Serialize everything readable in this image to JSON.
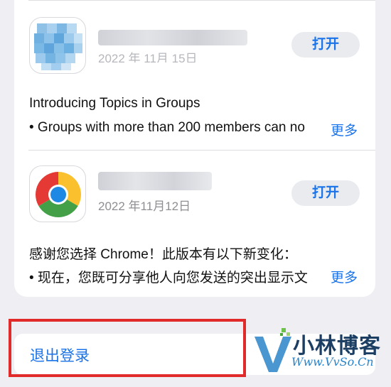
{
  "apps": [
    {
      "date": "2022 年 11月 15日",
      "open_label": "打开",
      "note_title": "Introducing Topics in Groups",
      "note_line": "• Groups with more than 200 members can no",
      "more_label": "更多"
    },
    {
      "date": "2022 年11月12日",
      "open_label": "打开",
      "note_title": "感谢您选择 Chrome！此版本有以下新变化：",
      "note_line": "• 现在，您既可分享他人向您发送的突出显示文",
      "more_label": "更多"
    }
  ],
  "signout": {
    "label": "退出登录"
  },
  "watermark": {
    "title": "小林博客",
    "url": "Www.VvSo.Cn"
  },
  "colors": {
    "accent": "#1a73e8",
    "highlight": "#e12a2a",
    "background": "#eeeef3"
  }
}
